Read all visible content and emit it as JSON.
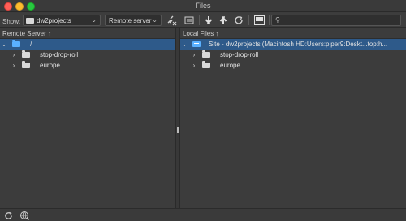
{
  "window": {
    "title": "Files"
  },
  "toolbar": {
    "show_label": "Show:",
    "site_select": {
      "value": "dw2projects"
    },
    "server_select": {
      "value": "Remote server"
    },
    "icons": [
      "disconnect-icon",
      "sync-icon",
      "get-icon",
      "put-icon",
      "refresh-icon",
      "expand-icon",
      "search-icon"
    ],
    "search_placeholder": ""
  },
  "remote_panel": {
    "header": "Remote Server",
    "sort_arrow": "↑",
    "items": [
      {
        "label": "/",
        "level": 0,
        "expanded": true,
        "selected": true,
        "icon": "folder-open-icon"
      },
      {
        "label": "stop-drop-roll",
        "level": 1,
        "expanded": false,
        "selected": false,
        "icon": "folder-icon"
      },
      {
        "label": "europe",
        "level": 1,
        "expanded": false,
        "selected": false,
        "icon": "folder-icon"
      }
    ]
  },
  "local_panel": {
    "header": "Local Files",
    "sort_arrow": "↑",
    "items": [
      {
        "label": "Site - dw2projects (Macintosh HD:Users:piper9:Deskt...top:h...",
        "level": 0,
        "expanded": true,
        "selected": true,
        "icon": "site-icon"
      },
      {
        "label": "stop-drop-roll",
        "level": 1,
        "expanded": false,
        "selected": false,
        "icon": "folder-icon"
      },
      {
        "label": "europe",
        "level": 1,
        "expanded": false,
        "selected": false,
        "icon": "folder-icon"
      }
    ]
  },
  "statusbar": {
    "icons": [
      "refresh-icon",
      "globe-icon"
    ]
  },
  "colors": {
    "selection": "#2e5a8a",
    "folder_accent": "#5ab0ff",
    "background": "#3c3c3c"
  }
}
